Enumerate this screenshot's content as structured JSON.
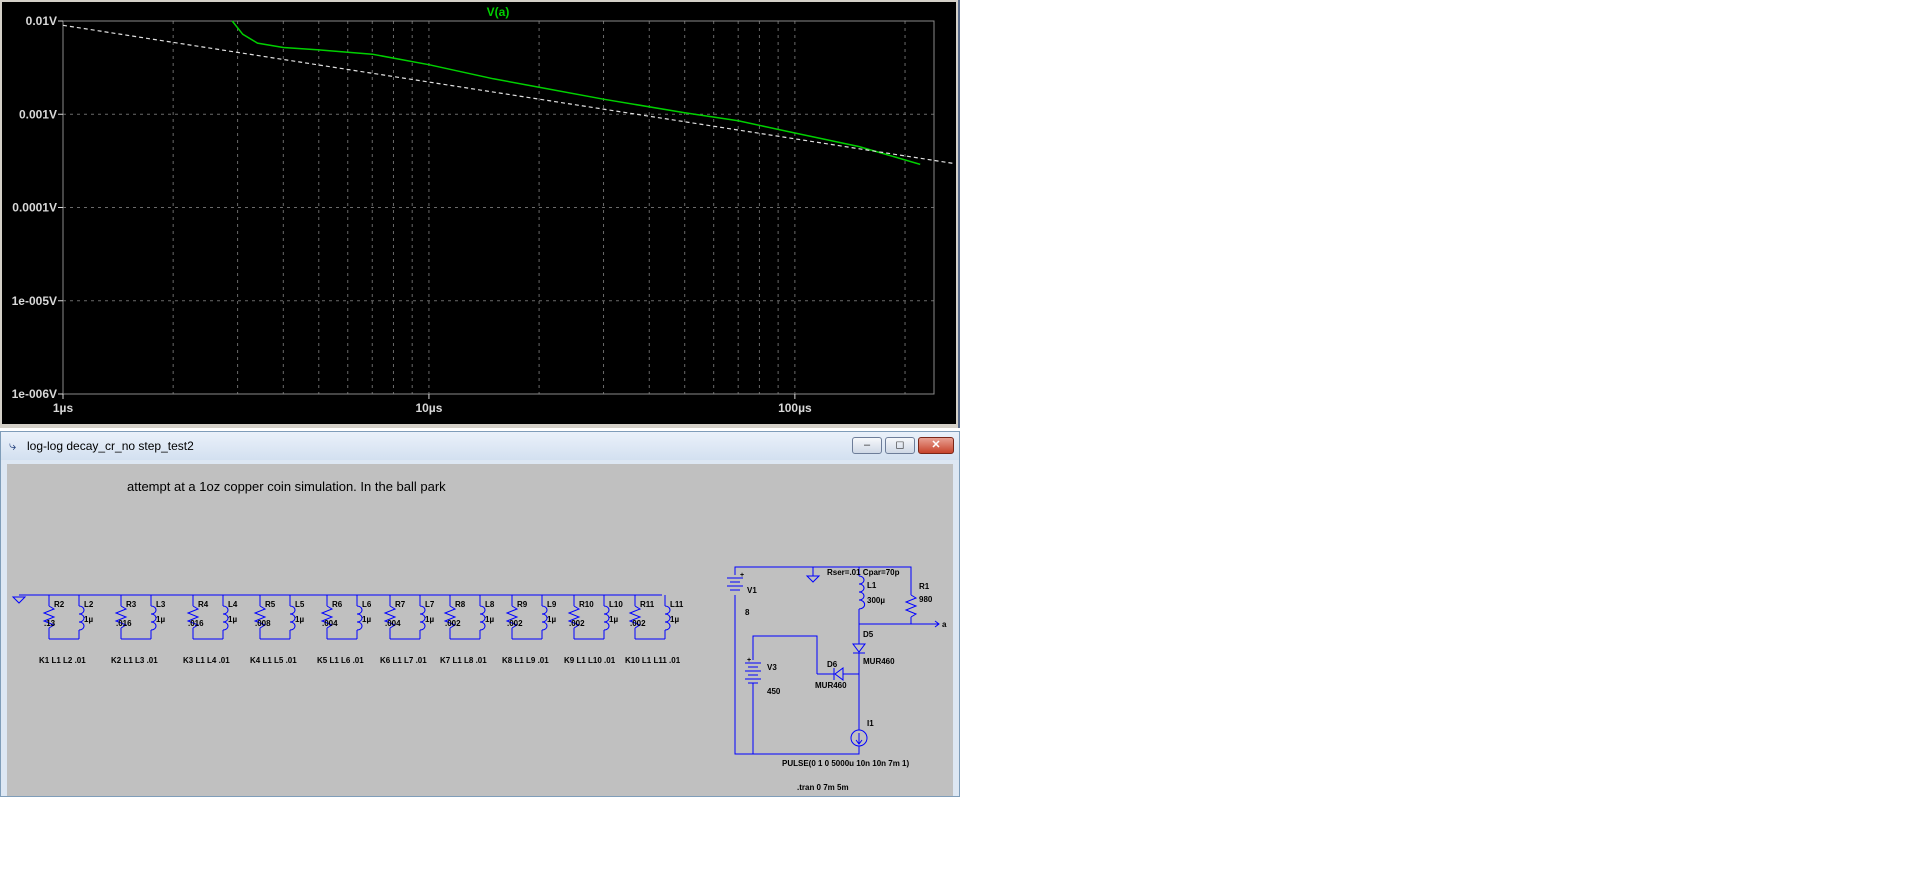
{
  "plot": {
    "trace_label": "V(a)",
    "trace_color": "#00d000",
    "background": "#000000",
    "y_ticks": [
      "0.01V",
      "0.001V",
      "0.0001V",
      "1e-005V",
      "1e-006V"
    ],
    "x_ticks": [
      "1µs",
      "10µs",
      "100µs"
    ]
  },
  "chart_data": {
    "type": "line",
    "title": "V(a)",
    "xscale": "log",
    "yscale": "log",
    "xlim": [
      1,
      240
    ],
    "ylim": [
      1e-06,
      0.01
    ],
    "x_unit": "µs",
    "y_unit": "V",
    "grid": true,
    "series": [
      {
        "name": "V(a)",
        "color": "#00d000",
        "x": [
          2.9,
          3.1,
          3.4,
          4.0,
          5.0,
          7.0,
          10,
          15,
          20,
          30,
          50,
          70,
          100,
          150,
          220
        ],
        "y": [
          0.01,
          0.0072,
          0.0058,
          0.0052,
          0.0049,
          0.0044,
          0.0034,
          0.0024,
          0.00195,
          0.00145,
          0.00104,
          0.00085,
          0.00063,
          0.00045,
          0.00029
        ]
      },
      {
        "name": "",
        "color": "#e0e0e0",
        "dashed": true,
        "x": [
          1,
          240
        ],
        "y": [
          0.009,
          0.00032
        ]
      }
    ]
  },
  "schematic": {
    "window_title": "log-log decay_cr_no step_test2",
    "comment": "attempt at a 1oz copper coin simulation. In the ball park",
    "wire_color": "#0000ff",
    "rl_pairs": [
      {
        "r": "R2",
        "rv": ".13",
        "l": "L2",
        "lv": "1µ",
        "k": "K1 L1 L2 .01"
      },
      {
        "r": "R3",
        "rv": ".016",
        "l": "L3",
        "lv": "1µ",
        "k": "K2 L1 L3 .01"
      },
      {
        "r": "R4",
        "rv": ".016",
        "l": "L4",
        "lv": "1µ",
        "k": "K3 L1 L4 .01"
      },
      {
        "r": "R5",
        "rv": ".008",
        "l": "L5",
        "lv": "1µ",
        "k": "K4 L1 L5 .01"
      },
      {
        "r": "R6",
        "rv": ".004",
        "l": "L6",
        "lv": "1µ",
        "k": "K5 L1 L6 .01"
      },
      {
        "r": "R7",
        "rv": ".004",
        "l": "L7",
        "lv": "1µ",
        "k": "K6 L1 L7 .01"
      },
      {
        "r": "R8",
        "rv": ".002",
        "l": "L8",
        "lv": "1µ",
        "k": "K7 L1 L8 .01"
      },
      {
        "r": "R9",
        "rv": ".002",
        "l": "L9",
        "lv": "1µ",
        "k": "K8 L1 L9 .01"
      },
      {
        "r": "R10",
        "rv": ".002",
        "l": "L10",
        "lv": "1µ",
        "k": "K9 L1 L10 .01"
      },
      {
        "r": "R11",
        "rv": ".002",
        "l": "L11",
        "lv": "1µ",
        "k": "K10 L1 L11 .01"
      }
    ],
    "v1": {
      "name": "V1",
      "value": "8"
    },
    "v3": {
      "name": "V3",
      "value": "450"
    },
    "l1": {
      "name": "L1",
      "value": "300µ",
      "params": "Rser=.01 Cpar=70p"
    },
    "r1": {
      "name": "R1",
      "value": "980"
    },
    "d5": {
      "name": "D5",
      "model": "MUR460"
    },
    "d6": {
      "name": "D6",
      "model": "MUR460"
    },
    "i1": {
      "name": "I1",
      "value": "PULSE(0 1 0 5000u 10n 10n 7m 1)"
    },
    "node_a": "a",
    "tran": ".tran 0 7m 5m"
  }
}
